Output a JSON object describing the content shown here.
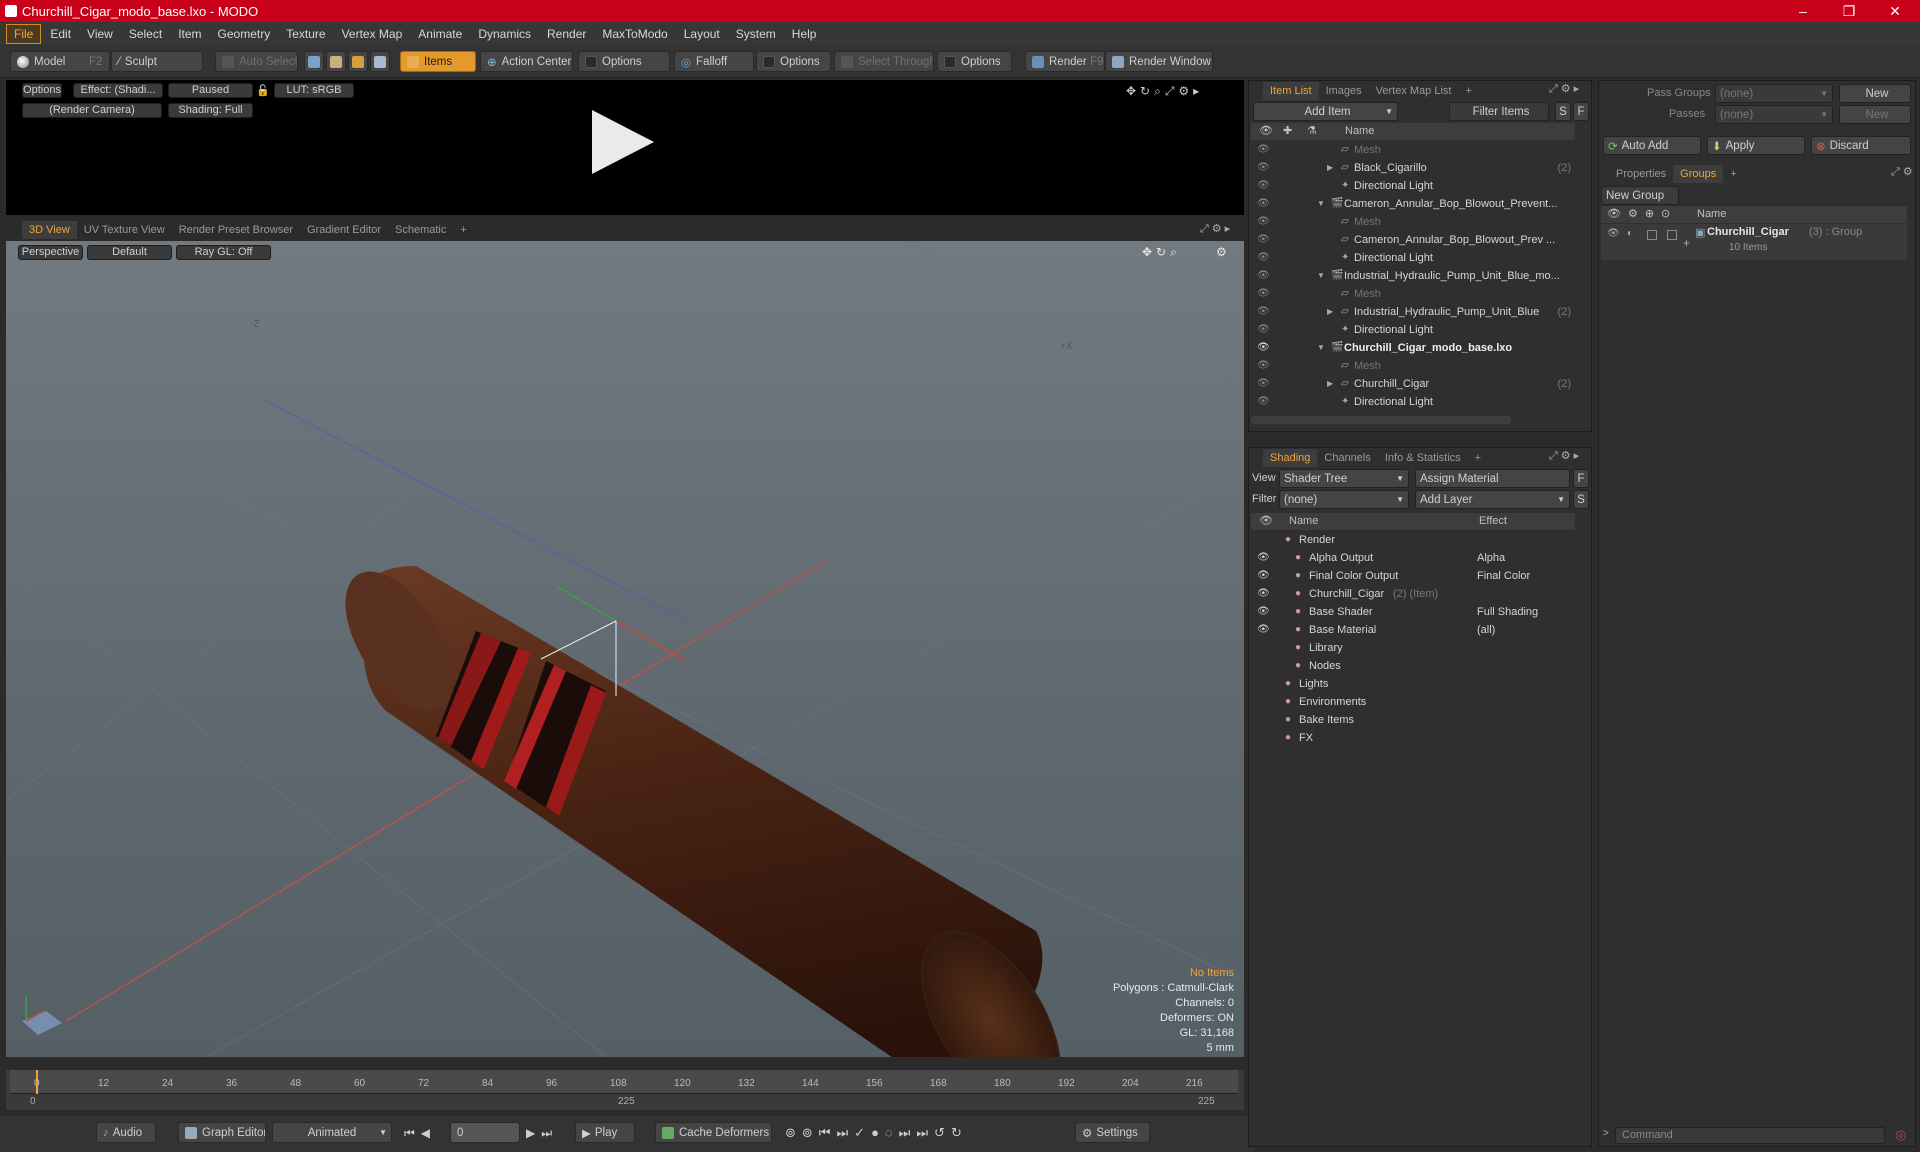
{
  "window": {
    "title": "Churchill_Cigar_modo_base.lxo - MODO",
    "controls": [
      "–",
      "❐",
      "✕"
    ]
  },
  "menu": [
    "File",
    "Edit",
    "View",
    "Select",
    "Item",
    "Geometry",
    "Texture",
    "Vertex Map",
    "Animate",
    "Dynamics",
    "Render",
    "MaxToModo",
    "Layout",
    "System",
    "Help"
  ],
  "toolbar": {
    "model": "Model",
    "model_key": "F2",
    "sculpt": "Sculpt",
    "auto_select": "Auto Select",
    "items": "Items",
    "action_center": "Action Center",
    "options1": "Options",
    "falloff": "Falloff",
    "options2": "Options",
    "select_through": "Select Through",
    "options3": "Options",
    "render": "Render",
    "render_key": "F9",
    "render_window": "Render Window"
  },
  "preview": {
    "options": "Options",
    "effect": "Effect: (Shadi...",
    "paused": "Paused",
    "lut": "LUT: sRGB",
    "camera": "(Render Camera)",
    "shading": "Shading: Full"
  },
  "view_tabs": [
    "3D View",
    "UV Texture View",
    "Render Preset Browser",
    "Gradient Editor",
    "Schematic",
    "+"
  ],
  "viewport": {
    "perspective": "Perspective",
    "default": "Default",
    "raygl": "Ray GL: Off",
    "axis_z": "-Z",
    "axis_x": "+X",
    "info": {
      "no_items": "No Items",
      "polygons": "Polygons : Catmull-Clark",
      "channels": "Channels: 0",
      "deformers": "Deformers: ON",
      "gl": "GL: 31,168",
      "scale": "5 mm"
    }
  },
  "timeline": {
    "ticks": [
      "0",
      "12",
      "24",
      "36",
      "48",
      "60",
      "72",
      "84",
      "96",
      "108",
      "120",
      "132",
      "144",
      "156",
      "168",
      "180",
      "192",
      "204",
      "216"
    ],
    "range_start": "0",
    "range_mid": "225",
    "range_end": "225"
  },
  "bottom": {
    "audio": "Audio",
    "graph_editor": "Graph Editor",
    "animated": "Animated",
    "frame": "0",
    "play": "Play",
    "cache_deformers": "Cache Deformers",
    "settings": "Settings"
  },
  "item_list": {
    "tabs": [
      "Item List",
      "Images",
      "Vertex Map List",
      "+"
    ],
    "add_item": "Add Item",
    "filter_items": "Filter Items",
    "s": "S",
    "f": "F",
    "col_name": "Name",
    "rows": [
      {
        "indent": 1,
        "label": "Mesh",
        "dim": true,
        "count": ""
      },
      {
        "indent": 1,
        "label": "Black_Cigarillo",
        "dim": false,
        "count": "(2)"
      },
      {
        "indent": 1,
        "label": "Directional Light",
        "dim": false,
        "count": ""
      },
      {
        "indent": 0,
        "label": "Cameron_Annular_Bop_Blowout_Prevent...",
        "dim": false,
        "count": ""
      },
      {
        "indent": 1,
        "label": "Mesh",
        "dim": true,
        "count": ""
      },
      {
        "indent": 1,
        "label": "Cameron_Annular_Bop_Blowout_Prev ...",
        "dim": false,
        "count": ""
      },
      {
        "indent": 1,
        "label": "Directional Light",
        "dim": false,
        "count": ""
      },
      {
        "indent": 0,
        "label": "Industrial_Hydraulic_Pump_Unit_Blue_mo...",
        "dim": false,
        "count": ""
      },
      {
        "indent": 1,
        "label": "Mesh",
        "dim": true,
        "count": ""
      },
      {
        "indent": 1,
        "label": "Industrial_Hydraulic_Pump_Unit_Blue",
        "dim": false,
        "count": "(2)"
      },
      {
        "indent": 1,
        "label": "Directional Light",
        "dim": false,
        "count": ""
      },
      {
        "indent": 0,
        "label": "Churchill_Cigar_modo_base.lxo",
        "dim": false,
        "count": "",
        "bold": true
      },
      {
        "indent": 1,
        "label": "Mesh",
        "dim": true,
        "count": ""
      },
      {
        "indent": 1,
        "label": "Churchill_Cigar",
        "dim": false,
        "count": "(2)"
      },
      {
        "indent": 1,
        "label": "Directional Light",
        "dim": false,
        "count": ""
      }
    ]
  },
  "shading": {
    "tabs": [
      "Shading",
      "Channels",
      "Info & Statistics",
      "+"
    ],
    "view_label": "View",
    "view_value": "Shader Tree",
    "assign_material": "Assign Material",
    "filter_label": "Filter",
    "filter_value": "(none)",
    "add_layer": "Add Layer",
    "f": "F",
    "s": "S",
    "col_name": "Name",
    "col_effect": "Effect",
    "rows": [
      {
        "indent": 0,
        "label": "Render",
        "effect": "",
        "eye": false
      },
      {
        "indent": 1,
        "label": "Alpha Output",
        "effect": "Alpha",
        "eye": true
      },
      {
        "indent": 1,
        "label": "Final Color Output",
        "effect": "Final Color",
        "eye": true
      },
      {
        "indent": 1,
        "label": "Churchill_Cigar",
        "suffix": "(2) (Item)",
        "effect": "",
        "eye": true
      },
      {
        "indent": 1,
        "label": "Base Shader",
        "effect": "Full Shading",
        "eye": true
      },
      {
        "indent": 1,
        "label": "Base Material",
        "effect": "(all)",
        "eye": true
      },
      {
        "indent": 1,
        "label": "Library",
        "effect": "",
        "eye": false
      },
      {
        "indent": 1,
        "label": "Nodes",
        "effect": "",
        "eye": false
      },
      {
        "indent": 0,
        "label": "Lights",
        "effect": "",
        "eye": false
      },
      {
        "indent": 0,
        "label": "Environments",
        "effect": "",
        "eye": false
      },
      {
        "indent": 0,
        "label": "Bake Items",
        "effect": "",
        "eye": false
      },
      {
        "indent": 0,
        "label": "FX",
        "effect": "",
        "eye": false
      }
    ]
  },
  "groups": {
    "pass_groups_label": "Pass Groups",
    "pass_groups_value": "(none)",
    "passes_label": "Passes",
    "passes_value": "(none)",
    "new1": "New",
    "new2": "New",
    "auto_add": "Auto Add",
    "apply": "Apply",
    "discard": "Discard",
    "tabs": [
      "Properties",
      "Groups",
      "+"
    ],
    "new_group": "New Group",
    "col_name": "Name",
    "group_name": "Churchill_Cigar",
    "group_suffix": "(3) : Group",
    "group_items": "10 Items"
  },
  "command": {
    "placeholder": "Command"
  }
}
